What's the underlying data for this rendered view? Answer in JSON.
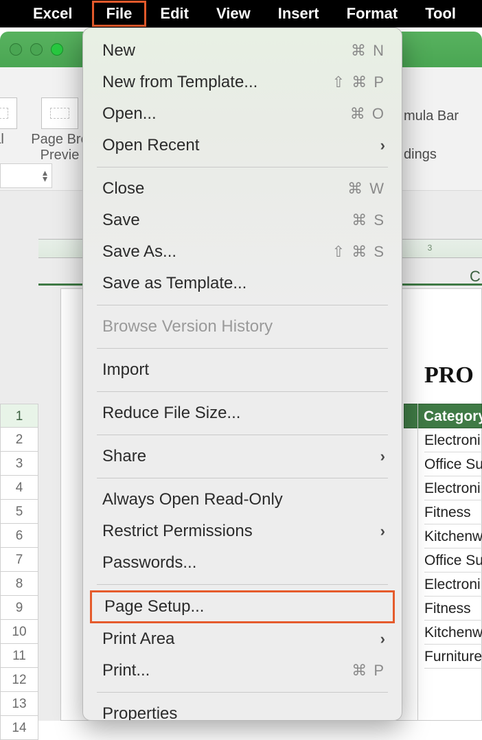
{
  "menubar": {
    "app": "Excel",
    "items": [
      "File",
      "Edit",
      "View",
      "Insert",
      "Format",
      "Tool"
    ],
    "active_index": 0
  },
  "ribbon": {
    "group1_label_line1": "al",
    "group2_label_line1": "Page Bre",
    "group2_label_line2": "Previe",
    "formula_bar_label": "mula Bar",
    "headings_label": "dings"
  },
  "file_menu": [
    {
      "label": "New",
      "shortcut": "⌘ N",
      "type": "item"
    },
    {
      "label": "New from Template...",
      "shortcut": "⇧ ⌘ P",
      "type": "item"
    },
    {
      "label": "Open...",
      "shortcut": "⌘ O",
      "type": "item"
    },
    {
      "label": "Open Recent",
      "submenu": true,
      "type": "item"
    },
    {
      "type": "sep"
    },
    {
      "label": "Close",
      "shortcut": "⌘ W",
      "type": "item"
    },
    {
      "label": "Save",
      "shortcut": "⌘ S",
      "type": "item"
    },
    {
      "label": "Save As...",
      "shortcut": "⇧ ⌘ S",
      "type": "item"
    },
    {
      "label": "Save as Template...",
      "type": "item"
    },
    {
      "type": "sep"
    },
    {
      "label": "Browse Version History",
      "type": "item",
      "disabled": true
    },
    {
      "type": "sep"
    },
    {
      "label": "Import",
      "type": "item"
    },
    {
      "type": "sep"
    },
    {
      "label": "Reduce File Size...",
      "type": "item"
    },
    {
      "type": "sep"
    },
    {
      "label": "Share",
      "submenu": true,
      "type": "item"
    },
    {
      "type": "sep"
    },
    {
      "label": "Always Open Read-Only",
      "type": "item"
    },
    {
      "label": "Restrict Permissions",
      "submenu": true,
      "type": "item"
    },
    {
      "label": "Passwords...",
      "type": "item"
    },
    {
      "type": "sep"
    },
    {
      "label": "Page Setup...",
      "type": "item",
      "highlight": true
    },
    {
      "label": "Print Area",
      "submenu": true,
      "type": "item"
    },
    {
      "label": "Print...",
      "shortcut": "⌘ P",
      "type": "item"
    },
    {
      "type": "sep"
    },
    {
      "label": "Properties",
      "type": "item"
    }
  ],
  "sheet": {
    "title_fragment": "PRO",
    "column_ruler_marks": [
      "3"
    ],
    "column_headers": [
      "C"
    ],
    "category_header": "Category",
    "rows": [
      1,
      2,
      3,
      4,
      5,
      6,
      7,
      8,
      9,
      10,
      11,
      12,
      13,
      14
    ],
    "categories": [
      "Electroni",
      "Office Su",
      "Electroni",
      "Fitness",
      "Kitchenw",
      "Office Su",
      "Electroni",
      "Fitness",
      "Kitchenw",
      "Furniture"
    ]
  }
}
